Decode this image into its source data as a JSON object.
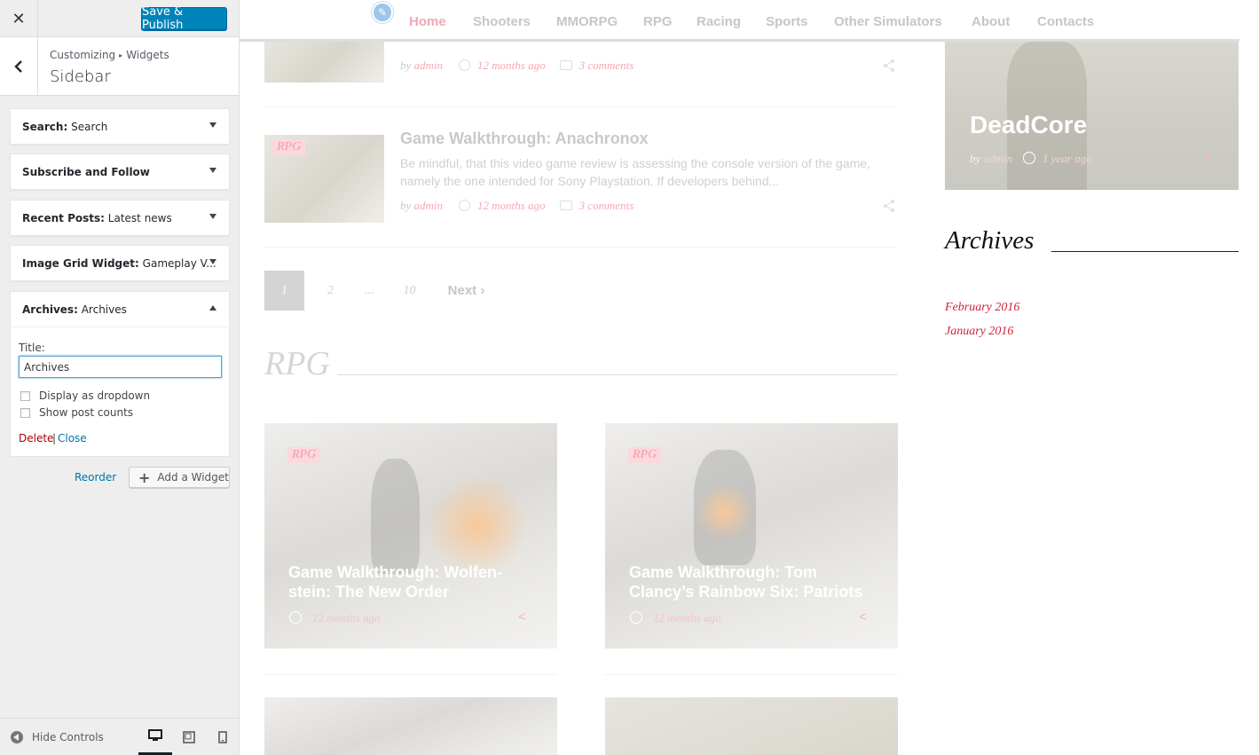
{
  "customizer": {
    "close_label": "✕",
    "save_label": "Save & Publish",
    "breadcrumb": {
      "parent": "Customizing",
      "separator": "▸",
      "child": "Widgets"
    },
    "section_name": "Sidebar",
    "widgets": [
      {
        "type": "Search",
        "title": "Search",
        "expanded": false
      },
      {
        "type": "Subscribe and Follow",
        "title": "",
        "expanded": false
      },
      {
        "type": "Recent Posts",
        "title": "Latest news",
        "expanded": false
      },
      {
        "type": "Image Grid Widget",
        "title": "Gameplay V...",
        "expanded": false
      },
      {
        "type": "Archives",
        "title": "Archives",
        "expanded": true
      }
    ],
    "archives_form": {
      "title_label": "Title:",
      "title_value": "Archives",
      "checkboxes": [
        {
          "label": "Display as dropdown",
          "checked": false
        },
        {
          "label": "Show post counts",
          "checked": false
        }
      ],
      "delete_label": "Delete",
      "separator": "|",
      "close_label": "Close"
    },
    "reorder_label": "Reorder",
    "add_widget_label": "Add a Widget",
    "hide_controls_label": "Hide Controls",
    "devices": [
      "desktop",
      "tablet",
      "mobile"
    ],
    "active_device": "desktop"
  },
  "preview": {
    "nav": [
      "Home",
      "Shooters",
      "MMORPG",
      "RPG",
      "Racing",
      "Sports",
      "Other Simulators",
      "About",
      "Contacts"
    ],
    "posts": [
      {
        "by": "by",
        "author": "admin",
        "date": "12 months ago",
        "comments": "3 comments"
      },
      {
        "tag": "RPG",
        "title": "Game Walkthrough: Anachronox",
        "excerpt": "Be mindful, that this video game review is assessing the console version of the game, namely the one intended for Sony Playstation. If developers behind...",
        "by": "by",
        "author": "admin",
        "date": "12 months ago",
        "comments": "3 comments"
      }
    ],
    "pagination": {
      "pages": [
        "1",
        "2",
        "...",
        "10"
      ],
      "current": "1",
      "next": "Next ›"
    },
    "section_heading": "RPG",
    "cards": [
      {
        "tag": "RPG",
        "title": "Game Walkthrough: Wolfen-stein: The New Order",
        "date": "12 months ago"
      },
      {
        "tag": "RPG",
        "title": "Game Walkthrough: Tom Clancy’s Rainbow Six: Patriots",
        "date": "12 months ago"
      }
    ],
    "featured": {
      "title": "DeadCore",
      "by": "by",
      "author": "admin",
      "date": "1 year ago"
    },
    "archives": {
      "heading": "Archives",
      "links": [
        "February 2016",
        "January 2016"
      ]
    },
    "colors": {
      "accent": "#d0243c",
      "primary_button": "#0085ba",
      "link": "#0073aa",
      "delete": "#aa0000"
    }
  }
}
